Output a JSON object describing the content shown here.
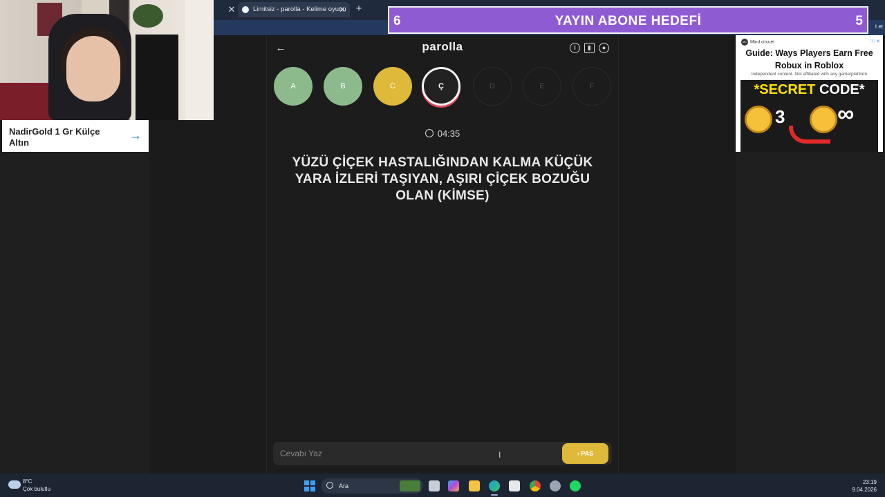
{
  "browser": {
    "tab_title": "Limitsiz - parolla - Kelime oyunu",
    "address_right_text": "t et"
  },
  "left_ad": {
    "text": "NadirGold 1 Gr Külçe Altın"
  },
  "game": {
    "logo": "parolla",
    "letters": [
      {
        "label": "A",
        "state": "correct"
      },
      {
        "label": "B",
        "state": "correct"
      },
      {
        "label": "C",
        "state": "passed"
      },
      {
        "label": "Ç",
        "state": "active"
      },
      {
        "label": "D",
        "state": "pending"
      },
      {
        "label": "E",
        "state": "pending"
      },
      {
        "label": "F",
        "state": "pending"
      }
    ],
    "timer": "04:35",
    "question": "YÜZÜ ÇİÇEK HASTALIĞINDAN KALMA KÜÇÜK YARA İZLERİ TAŞIYAN, AŞIRI ÇİÇEK BOZUĞU OLAN (KİMSE)",
    "answer_placeholder": "Cevabı Yaz",
    "answer_value": "",
    "pass_label": "PAS",
    "colors": {
      "correct": "#8dba8c",
      "passed": "#dfb93a",
      "active_ring": "#e0495f"
    }
  },
  "goal_banner": {
    "left_number": "6",
    "title": "YAYIN ABONE HEDEFİ",
    "right_number": "5",
    "color": "#8f5bd3"
  },
  "right_ad": {
    "brand": "Mind circuet",
    "brand_mark": "MC",
    "headline": "Guide: Ways Players Earn Free Robux in Roblox",
    "subtext": "Independent content. Not affiliated with any game/platform",
    "banner_a": "*SECRET",
    "banner_b": "CODE*",
    "count": "3",
    "infinity": "∞"
  },
  "taskbar": {
    "temperature": "8°C",
    "weather": "Çok bulutlu",
    "search_label": "Ara",
    "time": "23:19",
    "date": "9.04.2026"
  }
}
